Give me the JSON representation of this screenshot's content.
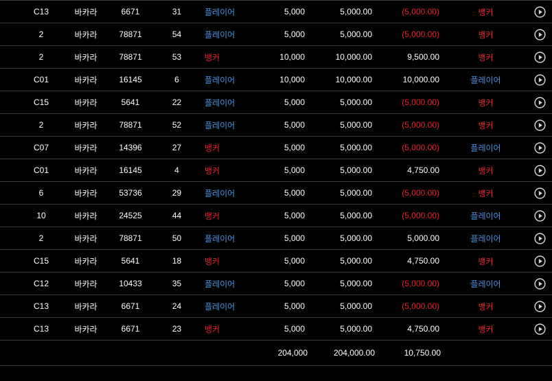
{
  "colors": {
    "player": "#4a90e2",
    "banker": "#e8212b",
    "loss": "#e8212b",
    "text": "#ffffff",
    "divider": "#3a3a3a"
  },
  "icons": {
    "row_action": "play-circle-icon"
  },
  "rows": [
    {
      "table": "C13",
      "game": "바카라",
      "room": "6671",
      "round": "31",
      "bet": "플레이어",
      "bet_side": "player",
      "amount": "5,000",
      "valid": "5,000.00",
      "win": "(5,000.00)",
      "win_loss": true,
      "result": "뱅커",
      "result_side": "banker"
    },
    {
      "table": "2",
      "game": "바카라",
      "room": "78871",
      "round": "54",
      "bet": "플레이어",
      "bet_side": "player",
      "amount": "5,000",
      "valid": "5,000.00",
      "win": "(5,000.00)",
      "win_loss": true,
      "result": "뱅커",
      "result_side": "banker"
    },
    {
      "table": "2",
      "game": "바카라",
      "room": "78871",
      "round": "53",
      "bet": "뱅커",
      "bet_side": "banker",
      "amount": "10,000",
      "valid": "10,000.00",
      "win": "9,500.00",
      "win_loss": false,
      "result": "뱅커",
      "result_side": "banker"
    },
    {
      "table": "C01",
      "game": "바카라",
      "room": "16145",
      "round": "6",
      "bet": "플레이어",
      "bet_side": "player",
      "amount": "10,000",
      "valid": "10,000.00",
      "win": "10,000.00",
      "win_loss": false,
      "result": "플레이어",
      "result_side": "player"
    },
    {
      "table": "C15",
      "game": "바카라",
      "room": "5641",
      "round": "22",
      "bet": "플레이어",
      "bet_side": "player",
      "amount": "5,000",
      "valid": "5,000.00",
      "win": "(5,000.00)",
      "win_loss": true,
      "result": "뱅커",
      "result_side": "banker"
    },
    {
      "table": "2",
      "game": "바카라",
      "room": "78871",
      "round": "52",
      "bet": "플레이어",
      "bet_side": "player",
      "amount": "5,000",
      "valid": "5,000.00",
      "win": "(5,000.00)",
      "win_loss": true,
      "result": "뱅커",
      "result_side": "banker"
    },
    {
      "table": "C07",
      "game": "바카라",
      "room": "14396",
      "round": "27",
      "bet": "뱅커",
      "bet_side": "banker",
      "amount": "5,000",
      "valid": "5,000.00",
      "win": "(5,000.00)",
      "win_loss": true,
      "result": "플레이어",
      "result_side": "player"
    },
    {
      "table": "C01",
      "game": "바카라",
      "room": "16145",
      "round": "4",
      "bet": "뱅커",
      "bet_side": "banker",
      "amount": "5,000",
      "valid": "5,000.00",
      "win": "4,750.00",
      "win_loss": false,
      "result": "뱅커",
      "result_side": "banker"
    },
    {
      "table": "6",
      "game": "바카라",
      "room": "53736",
      "round": "29",
      "bet": "플레이어",
      "bet_side": "player",
      "amount": "5,000",
      "valid": "5,000.00",
      "win": "(5,000.00)",
      "win_loss": true,
      "result": "뱅커",
      "result_side": "banker"
    },
    {
      "table": "10",
      "game": "바카라",
      "room": "24525",
      "round": "44",
      "bet": "뱅커",
      "bet_side": "banker",
      "amount": "5,000",
      "valid": "5,000.00",
      "win": "(5,000.00)",
      "win_loss": true,
      "result": "플레이어",
      "result_side": "player"
    },
    {
      "table": "2",
      "game": "바카라",
      "room": "78871",
      "round": "50",
      "bet": "플레이어",
      "bet_side": "player",
      "amount": "5,000",
      "valid": "5,000.00",
      "win": "5,000.00",
      "win_loss": false,
      "result": "플레이어",
      "result_side": "player"
    },
    {
      "table": "C15",
      "game": "바카라",
      "room": "5641",
      "round": "18",
      "bet": "뱅커",
      "bet_side": "banker",
      "amount": "5,000",
      "valid": "5,000.00",
      "win": "4,750.00",
      "win_loss": false,
      "result": "뱅커",
      "result_side": "banker"
    },
    {
      "table": "C12",
      "game": "바카라",
      "room": "10433",
      "round": "35",
      "bet": "플레이어",
      "bet_side": "player",
      "amount": "5,000",
      "valid": "5,000.00",
      "win": "(5,000.00)",
      "win_loss": true,
      "result": "플레이어",
      "result_side": "player"
    },
    {
      "table": "C13",
      "game": "바카라",
      "room": "6671",
      "round": "24",
      "bet": "플레이어",
      "bet_side": "player",
      "amount": "5,000",
      "valid": "5,000.00",
      "win": "(5,000.00)",
      "win_loss": true,
      "result": "뱅커",
      "result_side": "banker"
    },
    {
      "table": "C13",
      "game": "바카라",
      "room": "6671",
      "round": "23",
      "bet": "뱅커",
      "bet_side": "banker",
      "amount": "5,000",
      "valid": "5,000.00",
      "win": "4,750.00",
      "win_loss": false,
      "result": "뱅커",
      "result_side": "banker"
    }
  ],
  "totals": {
    "amount": "204,000",
    "valid": "204,000.00",
    "win": "10,750.00"
  }
}
